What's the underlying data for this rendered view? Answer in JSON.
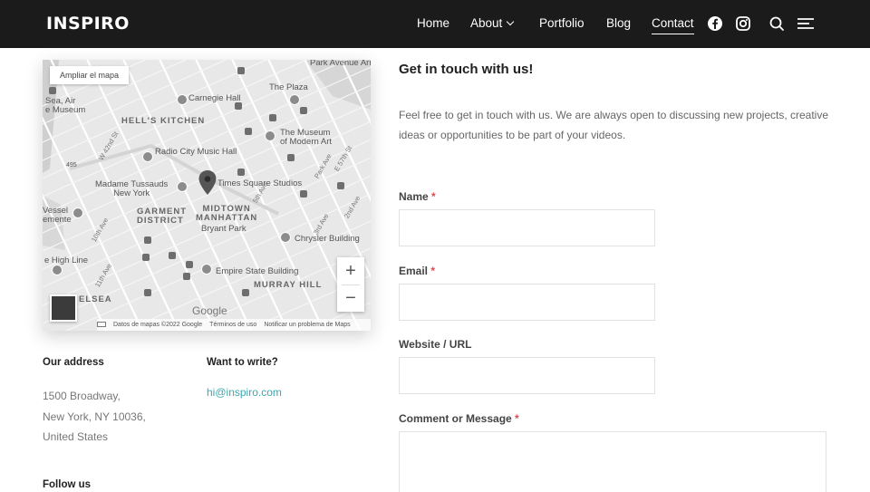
{
  "header": {
    "logo": "INSPIRO",
    "nav": [
      {
        "label": "Home"
      },
      {
        "label": "About"
      },
      {
        "label": "Portfolio"
      },
      {
        "label": "Blog"
      },
      {
        "label": "Contact"
      }
    ],
    "icons": [
      "facebook-icon",
      "instagram-icon",
      "search-icon",
      "menu-icon"
    ]
  },
  "map": {
    "expand_label": "Ampliar el mapa",
    "labels": {
      "hells_kitchen": "HELL'S KITCHEN",
      "carnegie": "Carnegie Hall",
      "plaza": "The Plaza",
      "park_ave": "Park Avenue Armo",
      "moma_1": "The Museum",
      "moma_2": "of Modern Art",
      "radio_city": "Radio City Music Hall",
      "times_square": "Times Square Studios",
      "tussauds_1": "Madame Tussauds",
      "tussauds_2": "New York",
      "garment_1": "GARMENT",
      "garment_2": "DISTRICT",
      "midtown_1": "MIDTOWN",
      "midtown_2": "MANHATTAN",
      "bryant": "Bryant Park",
      "chrysler": "Chrysler Building",
      "high_line": "e High Line",
      "empire": "Empire State Building",
      "murray": "MURRAY HILL",
      "chelsea": "ELSEA",
      "sea_air_1": "Sea, Air",
      "sea_air_2": "e Museum",
      "vessel_1": "Vessel",
      "vessel_2": "emente",
      "w42": "W 42nd St",
      "e57": "E 57th St",
      "route": "495",
      "ave10": "10th Ave",
      "ave3": "3rd Ave",
      "ave2": "2nd Ave",
      "ave_park": "Park Ave",
      "ave5": "5th Ave",
      "ave11": "11th Ave"
    },
    "zoom_in": "+",
    "zoom_out": "−",
    "google": "Google",
    "attribution": [
      "Datos de mapas ©2022 Google",
      "Términos de uso",
      "Notificar un problema de Maps"
    ]
  },
  "info": {
    "address_heading": "Our address",
    "address_lines": [
      "1500 Broadway,",
      "New York, NY 10036,",
      "United States"
    ],
    "write_heading": "Want to write?",
    "email": "hi@inspiro.com",
    "follow_heading": "Follow us"
  },
  "form": {
    "title": "Get in touch with us!",
    "lead": "Feel free to get in touch with us. We are always open to discussing new projects, creative ideas or opportunities to be part of your videos.",
    "name_label": "Name",
    "email_label": "Email",
    "website_label": "Website / URL",
    "comment_label": "Comment or Message",
    "required_mark": "*"
  }
}
